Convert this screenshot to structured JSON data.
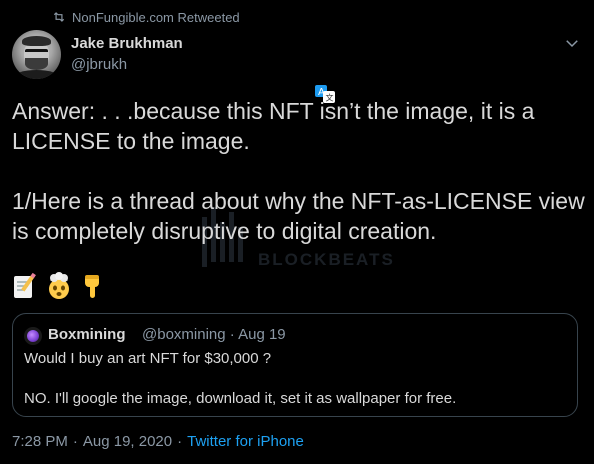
{
  "retweet": {
    "label": "NonFungible.com Retweeted",
    "icon": "retweet-icon"
  },
  "author": {
    "display_name": "Jake Brukhman",
    "handle": "@jbrukh",
    "avatar_icon": "user-avatar"
  },
  "menu_icon": "chevron-down-icon",
  "tweet": {
    "text": "Answer: . . .because this NFT isn’t the image, it is a LICENSE to the image.\n\n1/Here is a thread about why the NFT-as-LICENSE view is completely disruptive to digital creation.",
    "emojis": [
      "memo-emoji",
      "exploding-head-emoji",
      "pointing-down-emoji"
    ]
  },
  "watermark": {
    "text": "BLOCKBEATS"
  },
  "quoted_tweet": {
    "name": "Boxmining",
    "meta": "@boxmining · Aug 19",
    "line1": "Would I buy an art NFT for $30,000 ?",
    "line2": "NO. I'll google the image, download it, set it as wallpaper for free."
  },
  "footer": {
    "time": "7:28 PM",
    "sep1": "·",
    "date": "Aug 19, 2020",
    "sep2": "·",
    "source": "Twitter for iPhone"
  },
  "colors": {
    "background": "#000000",
    "text": "#d9d9d9",
    "secondary": "#8b98a5",
    "accent": "#1da1f2",
    "border": "#38444d"
  }
}
